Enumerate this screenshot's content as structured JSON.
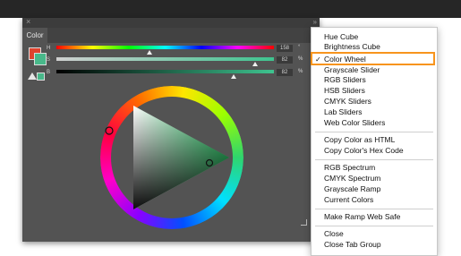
{
  "panel": {
    "tab": "Color",
    "close_glyph": "×",
    "collapse_glyph": "»",
    "sliders": [
      {
        "label": "H",
        "value": "158",
        "unit": "°",
        "position": 0.44
      },
      {
        "label": "S",
        "value": "82",
        "unit": "%",
        "position": 0.82
      },
      {
        "label": "B",
        "value": "82",
        "unit": "%",
        "position": 0.82
      }
    ],
    "colors": {
      "foreground": "#e0432e",
      "background": "#48b88a",
      "panel": "#535353"
    }
  },
  "menu": {
    "group1": [
      "Hue Cube",
      "Brightness Cube",
      "Color Wheel",
      "Grayscale Slider",
      "RGB Sliders",
      "HSB Sliders",
      "CMYK Sliders",
      "Lab Sliders",
      "Web Color Sliders"
    ],
    "checked": "Color Wheel",
    "check_glyph": "✓",
    "group2": [
      "Copy Color as HTML",
      "Copy Color's Hex Code"
    ],
    "group3": [
      "RGB Spectrum",
      "CMYK Spectrum",
      "Grayscale Ramp",
      "Current Colors"
    ],
    "group4": [
      "Make Ramp Web Safe"
    ],
    "group5": [
      "Close",
      "Close Tab Group"
    ]
  }
}
